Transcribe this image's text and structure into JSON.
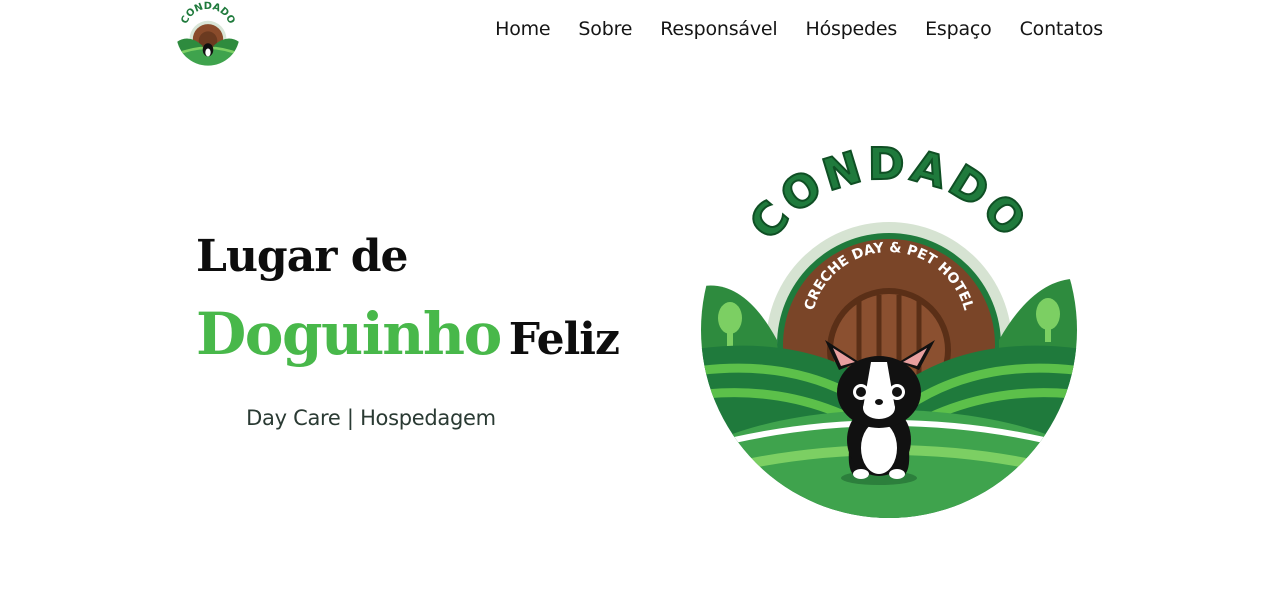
{
  "brand": {
    "name": "CONDADO",
    "subtitle": "CRECHE DAY & PET HOTEL"
  },
  "nav": {
    "items": [
      {
        "label": "Home"
      },
      {
        "label": "Sobre"
      },
      {
        "label": "Responsável"
      },
      {
        "label": "Hóspedes"
      },
      {
        "label": "Espaço"
      },
      {
        "label": "Contatos"
      }
    ]
  },
  "hero": {
    "line1": "Lugar de",
    "line2_green": "Doguinho",
    "line2_black": "Feliz",
    "tagline": "Day Care | Hospedagem"
  },
  "colors": {
    "accent_green": "#48b84a",
    "dark_green": "#1f7a3c",
    "wood_brown": "#7a4528",
    "text_dark": "#0d0d0d"
  }
}
